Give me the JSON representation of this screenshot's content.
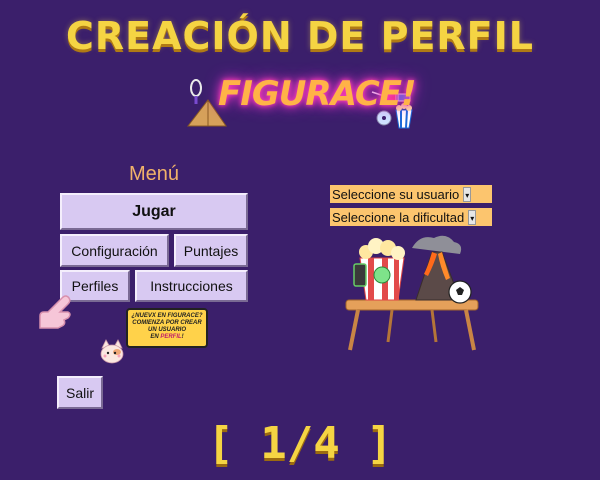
{
  "header": {
    "title": "CREACIÓN DE PERFIL",
    "logo_text": "FIGURACE!"
  },
  "menu": {
    "label": "Menú",
    "play_button": "Jugar",
    "settings_button": "Configuración",
    "scores_button": "Puntajes",
    "profiles_button": "Perfiles",
    "instructions_button": "Instrucciones",
    "exit_button": "Salir"
  },
  "selectors": {
    "user_select": "Seleccione su usuario",
    "difficulty_select": "Seleccione la dificultad"
  },
  "promo": {
    "line1": "¿NUEVX EN FIGURACE?",
    "line2": "COMIENZA POR CREAR",
    "line3": "UN USUARIO",
    "line4_prefix": "EN ",
    "line4_highlight": "PERFIL",
    "line4_suffix": "!"
  },
  "footer": {
    "page_counter": "[ 1/4 ]"
  },
  "colors": {
    "background": "#3b1f6b",
    "title": "#f5d443",
    "button": "#d8c9f2",
    "select": "#fcc56e",
    "menu_label": "#f0b26a"
  },
  "icons": [
    "pointing-hand-icon",
    "cat-icon",
    "popcorn-icon",
    "volcano-icon",
    "soccer-ball-icon",
    "table-icon",
    "pyramid-icon",
    "tennis-racket-icon",
    "3d-glasses-icon",
    "dvd-icon"
  ]
}
